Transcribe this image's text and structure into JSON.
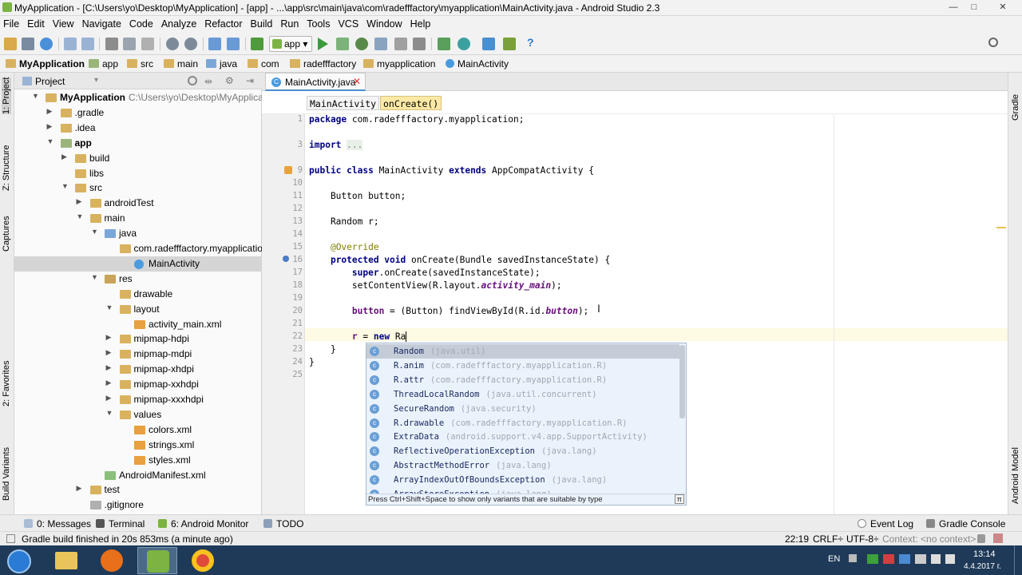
{
  "window": {
    "title": "MyApplication - [C:\\Users\\yo\\Desktop\\MyApplication] - [app] - ...\\app\\src\\main\\java\\com\\radefffactory\\myapplication\\MainActivity.java - Android Studio 2.3",
    "minimize": "—",
    "maximize": "□",
    "close": "✕"
  },
  "menu": [
    "File",
    "Edit",
    "View",
    "Navigate",
    "Code",
    "Analyze",
    "Refactor",
    "Build",
    "Run",
    "Tools",
    "VCS",
    "Window",
    "Help"
  ],
  "toolbar": {
    "run_config": "app",
    "help": "?"
  },
  "breadcrumb": [
    "MyApplication",
    "app",
    "src",
    "main",
    "java",
    "com",
    "radefffactory",
    "myapplication",
    "MainActivity"
  ],
  "left_strip": [
    "1: Project",
    "Z: Structure",
    "Captures",
    "2: Favorites",
    "Build Variants"
  ],
  "right_strip": [
    "Gradle",
    "Android Model"
  ],
  "project": {
    "header": "Project",
    "tree": [
      {
        "label": "MyApplication",
        "path": "C:\\Users\\yo\\Desktop\\MyApplication",
        "bold": true
      },
      {
        "label": ".gradle"
      },
      {
        "label": ".idea"
      },
      {
        "label": "app",
        "bold": true
      },
      {
        "label": "build"
      },
      {
        "label": "libs"
      },
      {
        "label": "src"
      },
      {
        "label": "androidTest"
      },
      {
        "label": "main"
      },
      {
        "label": "java"
      },
      {
        "label": "com.radefffactory.myapplication"
      },
      {
        "label": "MainActivity"
      },
      {
        "label": "res"
      },
      {
        "label": "drawable"
      },
      {
        "label": "layout"
      },
      {
        "label": "activity_main.xml"
      },
      {
        "label": "mipmap-hdpi"
      },
      {
        "label": "mipmap-mdpi"
      },
      {
        "label": "mipmap-xhdpi"
      },
      {
        "label": "mipmap-xxhdpi"
      },
      {
        "label": "mipmap-xxxhdpi"
      },
      {
        "label": "values"
      },
      {
        "label": "colors.xml"
      },
      {
        "label": "strings.xml"
      },
      {
        "label": "styles.xml"
      },
      {
        "label": "AndroidManifest.xml"
      },
      {
        "label": "test"
      },
      {
        "label": ".gitignore"
      }
    ]
  },
  "editor": {
    "tab": "MainActivity.java",
    "crumbs": [
      "MainActivity",
      "onCreate()"
    ],
    "lines": [
      "1",
      "3",
      "9",
      "10",
      "11",
      "12",
      "13",
      "14",
      "15",
      "16",
      "17",
      "18",
      "19",
      "20",
      "21",
      "22",
      "23",
      "24",
      "25"
    ],
    "code": {
      "package_kw": "package",
      "package_name": " com.radefffactory.myapplication;",
      "import_kw": "import",
      "import_fold": "...",
      "class_kw": "public class",
      "class_name": " MainActivity ",
      "extends_kw": "extends",
      "class_rest": " AppCompatActivity {",
      "button_decl": "    Button button;",
      "random_decl": "    Random r;",
      "override": "@Override",
      "oncreate_kw": "protected void",
      "oncreate_rest": " onCreate(Bundle savedInstanceState) {",
      "super_kw": "super",
      "super_rest": ".onCreate(savedInstanceState);",
      "setcv_a": "setContentView(R.layout.",
      "setcv_b": "activity_main",
      "setcv_c": ");",
      "btn_a": "button",
      "btn_b": " = (Button) findViewById(R.id.",
      "btn_c": "button",
      "btn_d": ");",
      "r_a": "r",
      "r_b": " = ",
      "r_new": "new",
      "r_c": " Ra",
      "close_method": "}",
      "close_class": "}"
    }
  },
  "autocomplete": {
    "items": [
      {
        "name": "Random",
        "pkg": "(java.util)",
        "icon": "c"
      },
      {
        "name": "R.anim",
        "pkg": "(com.radefffactory.myapplication.R)",
        "icon": "c"
      },
      {
        "name": "R.attr",
        "pkg": "(com.radefffactory.myapplication.R)",
        "icon": "c"
      },
      {
        "name": "ThreadLocalRandom",
        "pkg": "(java.util.concurrent)",
        "icon": "c"
      },
      {
        "name": "SecureRandom",
        "pkg": "(java.security)",
        "icon": "c"
      },
      {
        "name": "R.drawable",
        "pkg": "(com.radefffactory.myapplication.R)",
        "icon": "c"
      },
      {
        "name": "ExtraData",
        "pkg": "(android.support.v4.app.SupportActivity)",
        "icon": "c"
      },
      {
        "name": "ReflectiveOperationException",
        "pkg": "(java.lang)",
        "icon": "c"
      },
      {
        "name": "AbstractMethodError",
        "pkg": "(java.lang)",
        "icon": "c"
      },
      {
        "name": "ArrayIndexOutOfBoundsException",
        "pkg": "(java.lang)",
        "icon": "c"
      },
      {
        "name": "ArrayStoreException",
        "pkg": "(java.lang)",
        "icon": "c"
      }
    ],
    "hint": "Press Ctrl+Shift+Space to show only variants that are suitable by type",
    "pi": "π"
  },
  "bottom_tools": [
    "0: Messages",
    "Terminal",
    "6: Android Monitor",
    "TODO",
    "Event Log",
    "Gradle Console"
  ],
  "status": {
    "message": "Gradle build finished in 20s 853ms (a minute ago)",
    "position": "22:19",
    "line_sep": "CRLF÷",
    "encoding": "UTF-8÷",
    "context": "Context: <no context>"
  },
  "taskbar": {
    "lang": "EN",
    "time": "13:14",
    "date": "4.4.2017 г."
  }
}
